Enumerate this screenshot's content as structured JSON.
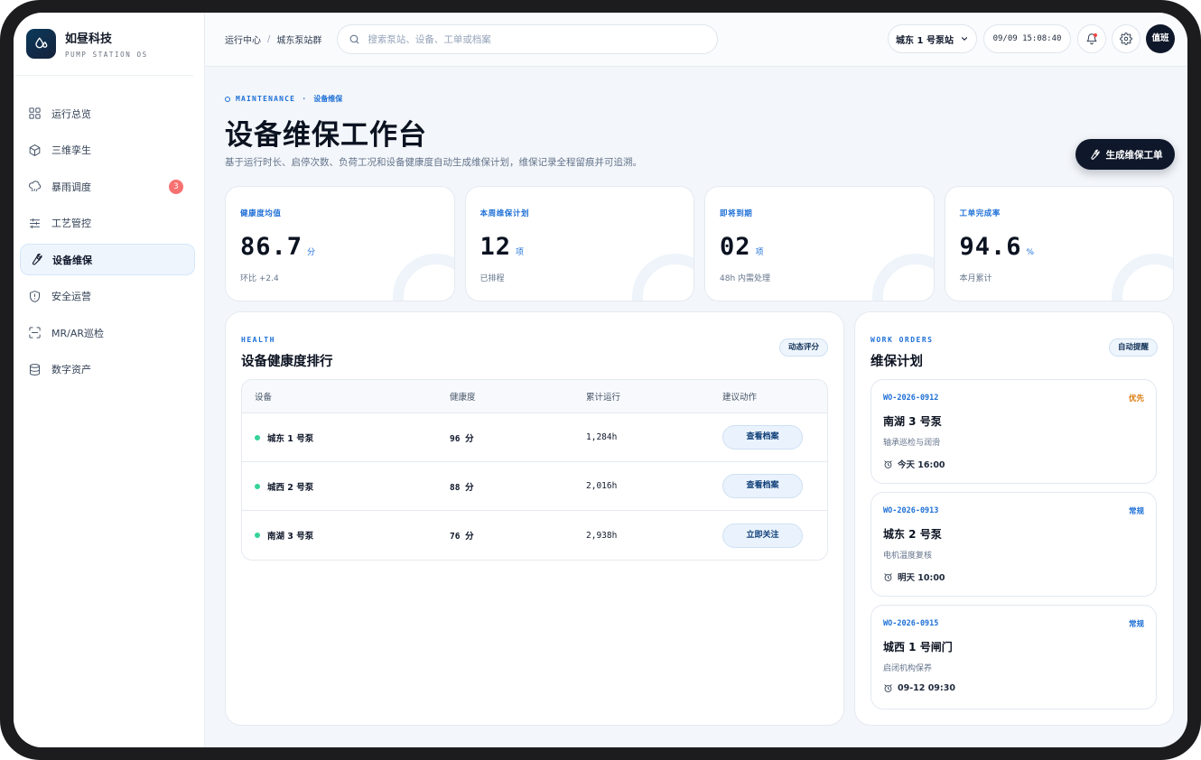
{
  "brand": {
    "name": "如昼科技",
    "subtitle": "PUMP STATION OS"
  },
  "nav": {
    "items": [
      {
        "label": "运行总览",
        "icon": "grid-icon"
      },
      {
        "label": "三维孪生",
        "icon": "cube-icon"
      },
      {
        "label": "暴雨调度",
        "icon": "rain-cloud-icon",
        "badge": "3"
      },
      {
        "label": "工艺管控",
        "icon": "sliders-icon"
      },
      {
        "label": "设备维保",
        "icon": "wrench-icon",
        "active": true
      },
      {
        "label": "安全运营",
        "icon": "shield-icon"
      },
      {
        "label": "MR/AR巡检",
        "icon": "scan-icon"
      },
      {
        "label": "数字资产",
        "icon": "database-icon"
      }
    ]
  },
  "topbar": {
    "breadcrumb": [
      "运行中心",
      "城东泵站群"
    ],
    "breadcrumb_sep": "/",
    "search_placeholder": "搜索泵站、设备、工单或档案",
    "station": "城东 1 号泵站",
    "clock": "09/09 15:08:40",
    "user": "值班"
  },
  "header": {
    "eyebrow_en": "MAINTENANCE",
    "eyebrow_sep": "·",
    "eyebrow_cn": "设备维保",
    "title": "设备维保工作台",
    "description": "基于运行时长、启停次数、负荷工况和设备健康度自动生成维保计划，维保记录全程留痕并可追溯。",
    "primary_action": "生成维保工单"
  },
  "kpis": [
    {
      "label": "健康度均值",
      "value": "86.7",
      "unit": "分",
      "sub": "环比 +2.4"
    },
    {
      "label": "本周维保计划",
      "value": "12",
      "unit": "项",
      "sub": "已排程"
    },
    {
      "label": "即将到期",
      "value": "02",
      "unit": "项",
      "sub": "48h 内需处理"
    },
    {
      "label": "工单完成率",
      "value": "94.6",
      "unit": "%",
      "sub": "本月累计"
    }
  ],
  "health": {
    "eyebrow": "HEALTH",
    "title": "设备健康度排行",
    "tag": "动态评分",
    "columns": [
      "设备",
      "健康度",
      "累计运行",
      "建议动作"
    ],
    "rows": [
      {
        "device": "城东 1 号泵",
        "score": "96 分",
        "runtime": "1,284h",
        "action": "查看档案"
      },
      {
        "device": "城西 2 号泵",
        "score": "88 分",
        "runtime": "2,016h",
        "action": "查看档案"
      },
      {
        "device": "南湖 3 号泵",
        "score": "76 分",
        "runtime": "2,938h",
        "action": "立即关注"
      }
    ]
  },
  "orders": {
    "eyebrow": "WORK ORDERS",
    "title": "维保计划",
    "tag": "自动提醒",
    "items": [
      {
        "id": "WO-2026-0912",
        "priority": "优先",
        "priority_color": "#d97706",
        "title": "南湖 3 号泵",
        "task": "轴承巡检与润滑",
        "time": "今天 16:00"
      },
      {
        "id": "WO-2026-0913",
        "priority": "常规",
        "priority_color": "#1d6fd6",
        "title": "城东 2 号泵",
        "task": "电机温度复核",
        "time": "明天 10:00"
      },
      {
        "id": "WO-2026-0915",
        "priority": "常规",
        "priority_color": "#1d6fd6",
        "title": "城西 1 号闸门",
        "task": "启闭机构保养",
        "time": "09-12 09:30"
      }
    ]
  },
  "colors": {
    "accent": "#1d6fd6",
    "dark": "#0f172a",
    "healthy": "#34d399",
    "badge": "#f87171"
  }
}
